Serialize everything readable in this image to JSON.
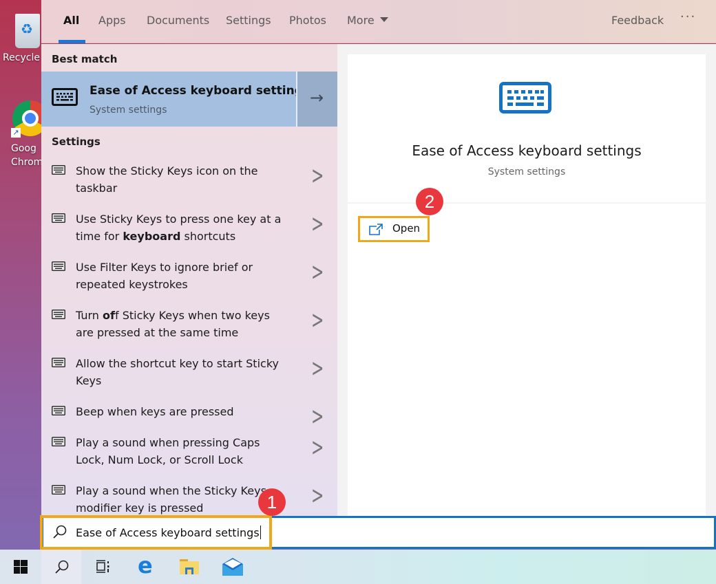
{
  "desktop": {
    "icons": [
      {
        "label": "Recycle",
        "icon": "recycle-bin-icon"
      },
      {
        "label": "Goog Chrom",
        "icon": "chrome-icon"
      }
    ]
  },
  "search_panel": {
    "tabs": [
      {
        "label": "All",
        "active": true
      },
      {
        "label": "Apps"
      },
      {
        "label": "Documents"
      },
      {
        "label": "Settings"
      },
      {
        "label": "Photos"
      },
      {
        "label": "More",
        "dropdown": true
      }
    ],
    "feedback_label": "Feedback",
    "more_options_icon": "ellipsis-icon",
    "best_match": {
      "heading": "Best match",
      "title": "Ease of Access keyboard settings",
      "subtitle": "System settings",
      "icon": "keyboard-icon",
      "arrow_icon": "arrow-right-icon"
    },
    "settings": {
      "heading": "Settings",
      "items": [
        {
          "pre": "Show the Sticky Keys icon on the taskbar",
          "bold": "",
          "post": ""
        },
        {
          "pre": "Use Sticky Keys to press one key at a time for ",
          "bold": "keyboard",
          "post": " shortcuts"
        },
        {
          "pre": "Use Filter Keys to ignore brief or repeated keystrokes",
          "bold": "",
          "post": ""
        },
        {
          "pre": "Turn ",
          "bold": "of",
          "post": "f Sticky Keys when two keys are pressed at the same time"
        },
        {
          "pre": "Allow the shortcut key to start Sticky Keys",
          "bold": "",
          "post": ""
        },
        {
          "pre": "Beep when keys are pressed",
          "bold": "",
          "post": ""
        },
        {
          "pre": "Play a sound when pressing Caps Lock, Num Lock, or Scroll Lock",
          "bold": "",
          "post": ""
        },
        {
          "pre": "Play a sound when the Sticky Keys modifier key is pressed",
          "bold": "",
          "post": ""
        }
      ]
    },
    "preview": {
      "title": "Ease of Access keyboard settings",
      "subtitle": "System settings",
      "open_label": "Open",
      "open_icon": "open-external-icon"
    }
  },
  "search_box": {
    "value": "Ease of Access keyboard settings",
    "icon": "search-icon"
  },
  "annotations": [
    {
      "number": "1",
      "target": "search box"
    },
    {
      "number": "2",
      "target": "Open button"
    }
  ],
  "taskbar": {
    "items": [
      {
        "name": "start",
        "icon": "windows-logo-icon"
      },
      {
        "name": "search",
        "icon": "search-icon",
        "active": true
      },
      {
        "name": "task-view",
        "icon": "task-view-icon"
      },
      {
        "name": "edge",
        "icon": "edge-icon"
      },
      {
        "name": "file-explorer",
        "icon": "folder-icon"
      },
      {
        "name": "mail",
        "icon": "mail-icon"
      }
    ]
  },
  "colors": {
    "accent": "#1878d6",
    "highlight_box": "#f0a81b",
    "badge": "#e8383d",
    "best_match_bg": "#a5bfe0"
  }
}
